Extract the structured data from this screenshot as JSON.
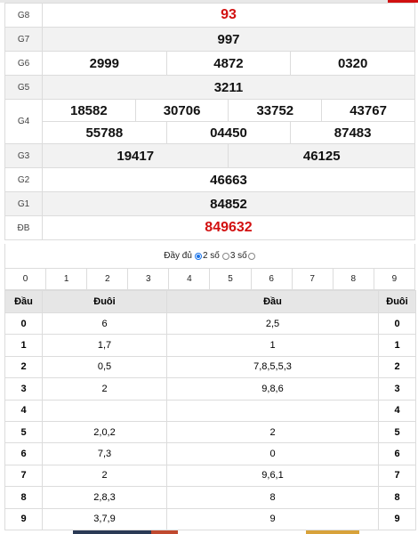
{
  "prizes": {
    "g8": {
      "label": "G8",
      "values": [
        "93"
      ]
    },
    "g7": {
      "label": "G7",
      "values": [
        "997"
      ]
    },
    "g6": {
      "label": "G6",
      "values": [
        "2999",
        "4872",
        "0320"
      ]
    },
    "g5": {
      "label": "G5",
      "values": [
        "3211"
      ]
    },
    "g4": {
      "label": "G4",
      "row1": [
        "18582",
        "30706",
        "33752",
        "43767"
      ],
      "row2": [
        "55788",
        "04450",
        "87483"
      ]
    },
    "g3": {
      "label": "G3",
      "values": [
        "19417",
        "46125"
      ]
    },
    "g2": {
      "label": "G2",
      "values": [
        "46663"
      ]
    },
    "g1": {
      "label": "G1",
      "values": [
        "84852"
      ]
    },
    "db": {
      "label": "ĐB",
      "values": [
        "849632"
      ]
    }
  },
  "options": {
    "full": "Đầy đủ",
    "two": "2 số",
    "three": "3 số",
    "selected": "two"
  },
  "digits": [
    "0",
    "1",
    "2",
    "3",
    "4",
    "5",
    "6",
    "7",
    "8",
    "9"
  ],
  "loto": {
    "headers": [
      "Đầu",
      "Đuôi",
      "Đầu",
      "Đuôi"
    ],
    "rows": [
      {
        "dau": "0",
        "duoi": "6",
        "dau2": "2,5",
        "duoi2": "0"
      },
      {
        "dau": "1",
        "duoi": "1,7",
        "dau2": "1",
        "duoi2": "1"
      },
      {
        "dau": "2",
        "duoi": "0,5",
        "dau2": "7,8,5,5,3",
        "duoi2": "2"
      },
      {
        "dau": "3",
        "duoi": "2",
        "dau2": "9,8,6",
        "duoi2": "3"
      },
      {
        "dau": "4",
        "duoi": "",
        "dau2": "",
        "duoi2": "4"
      },
      {
        "dau": "5",
        "duoi": "2,0,2",
        "dau2": "2",
        "duoi2": "5"
      },
      {
        "dau": "6",
        "duoi": "7,3",
        "dau2": "0",
        "duoi2": "6"
      },
      {
        "dau": "7",
        "duoi": "2",
        "dau2": "9,6,1",
        "duoi2": "7"
      },
      {
        "dau": "8",
        "duoi": "2,8,3",
        "dau2": "8",
        "duoi2": "8"
      },
      {
        "dau": "9",
        "duoi": "3,7,9",
        "dau2": "9",
        "duoi2": "9"
      }
    ]
  },
  "colors": {
    "accent_red": "#d21010",
    "radio_blue": "#1a73e8",
    "header_gray": "#e6e6e6"
  }
}
